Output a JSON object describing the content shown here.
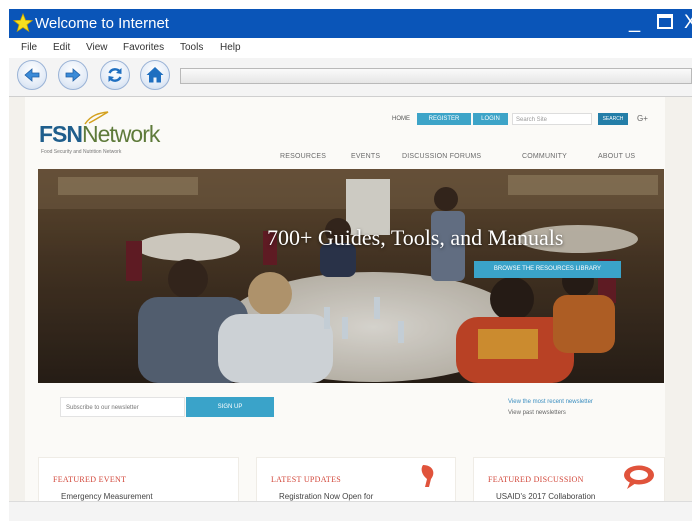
{
  "window": {
    "title": "Welcome to Internet",
    "controls": {
      "minimize": "_",
      "close": "X"
    }
  },
  "menu": [
    "File",
    "Edit",
    "View",
    "Favorites",
    "Tools",
    "Help"
  ],
  "toolbar": {
    "buttons": [
      "back-icon",
      "forward-icon",
      "refresh-icon",
      "home-icon"
    ],
    "address": ""
  },
  "site": {
    "logo": {
      "fsn": "FSN",
      "rest": "etwork",
      "tagline": "Food Security and Nutrition Network"
    },
    "top_nav": {
      "home": "HOME",
      "register": "REGISTER",
      "login": "LOGIN",
      "search_placeholder": "Search Site",
      "search_button": "SEARCH",
      "language": "G+"
    },
    "main_nav": [
      "RESOURCES",
      "EVENTS",
      "DISCUSSION FORUMS",
      "COMMUNITY",
      "ABOUT US"
    ],
    "hero": {
      "title": "700+ Guides, Tools, and Manuals",
      "cta": "BROWSE THE RESOURCES LIBRARY"
    },
    "newsletter": {
      "placeholder": "Subscribe to our newsletter",
      "button": "SIGN UP",
      "link_recent": "View the most recent newsletter",
      "link_past": "View past newsletters"
    },
    "cards": [
      {
        "title": "FEATURED EVENT",
        "text": "Emergency Measurement"
      },
      {
        "title": "LATEST UPDATES",
        "text": "Registration Now Open for"
      },
      {
        "title": "FEATURED DISCUSSION",
        "text": "USAID's 2017 Collaboration"
      }
    ]
  },
  "colors": {
    "titlebar": "#0a55b8",
    "accent_blue": "#3aa3c9",
    "card_title_red": "#d2473a"
  }
}
